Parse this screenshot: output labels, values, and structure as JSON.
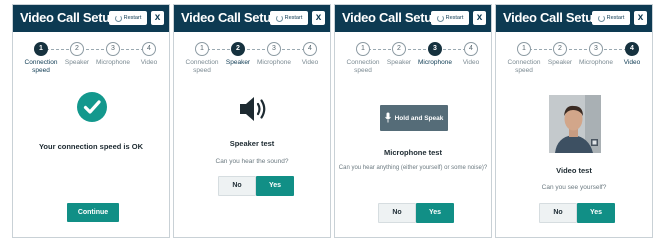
{
  "colors": {
    "titlebar": "#0d3a52",
    "accent": "#118f86",
    "check": "#13988d",
    "step_active": "#16323f"
  },
  "panels": [
    {
      "title": "Video Call Setup",
      "restart_label": "Restart",
      "close_label": "x",
      "active_step": 1,
      "steps": [
        {
          "num": "1",
          "label": "Connection speed"
        },
        {
          "num": "2",
          "label": "Speaker"
        },
        {
          "num": "3",
          "label": "Microphone"
        },
        {
          "num": "4",
          "label": "Video"
        }
      ],
      "icon": "checkmark-circle-icon",
      "heading": "Your connection speed is OK",
      "button": "Continue"
    },
    {
      "title": "Video Call Setup",
      "restart_label": "Restart",
      "close_label": "x",
      "active_step": 2,
      "steps": [
        {
          "num": "1",
          "label": "Connection speed"
        },
        {
          "num": "2",
          "label": "Speaker"
        },
        {
          "num": "3",
          "label": "Microphone"
        },
        {
          "num": "4",
          "label": "Video"
        }
      ],
      "icon": "speaker-volume-icon",
      "heading": "Speaker test",
      "question": "Can you hear the sound?",
      "no": "No",
      "yes": "Yes"
    },
    {
      "title": "Video Call Setup",
      "restart_label": "Restart",
      "close_label": "x",
      "active_step": 3,
      "steps": [
        {
          "num": "1",
          "label": "Connection speed"
        },
        {
          "num": "2",
          "label": "Speaker"
        },
        {
          "num": "3",
          "label": "Microphone"
        },
        {
          "num": "4",
          "label": "Video"
        }
      ],
      "icon": "microphone-icon",
      "hold_label": "Hold and Speak",
      "heading": "Microphone test",
      "question": "Can you hear anything (either yourself) or some noise)?",
      "no": "No",
      "yes": "Yes"
    },
    {
      "title": "Video Call Setup",
      "restart_label": "Restart",
      "close_label": "x",
      "active_step": 4,
      "steps": [
        {
          "num": "1",
          "label": "Connection speed"
        },
        {
          "num": "2",
          "label": "Speaker"
        },
        {
          "num": "3",
          "label": "Microphone"
        },
        {
          "num": "4",
          "label": "Video"
        }
      ],
      "icon": "webcam-preview",
      "heading": "Video test",
      "question": "Can you see yourself?",
      "no": "No",
      "yes": "Yes"
    }
  ]
}
